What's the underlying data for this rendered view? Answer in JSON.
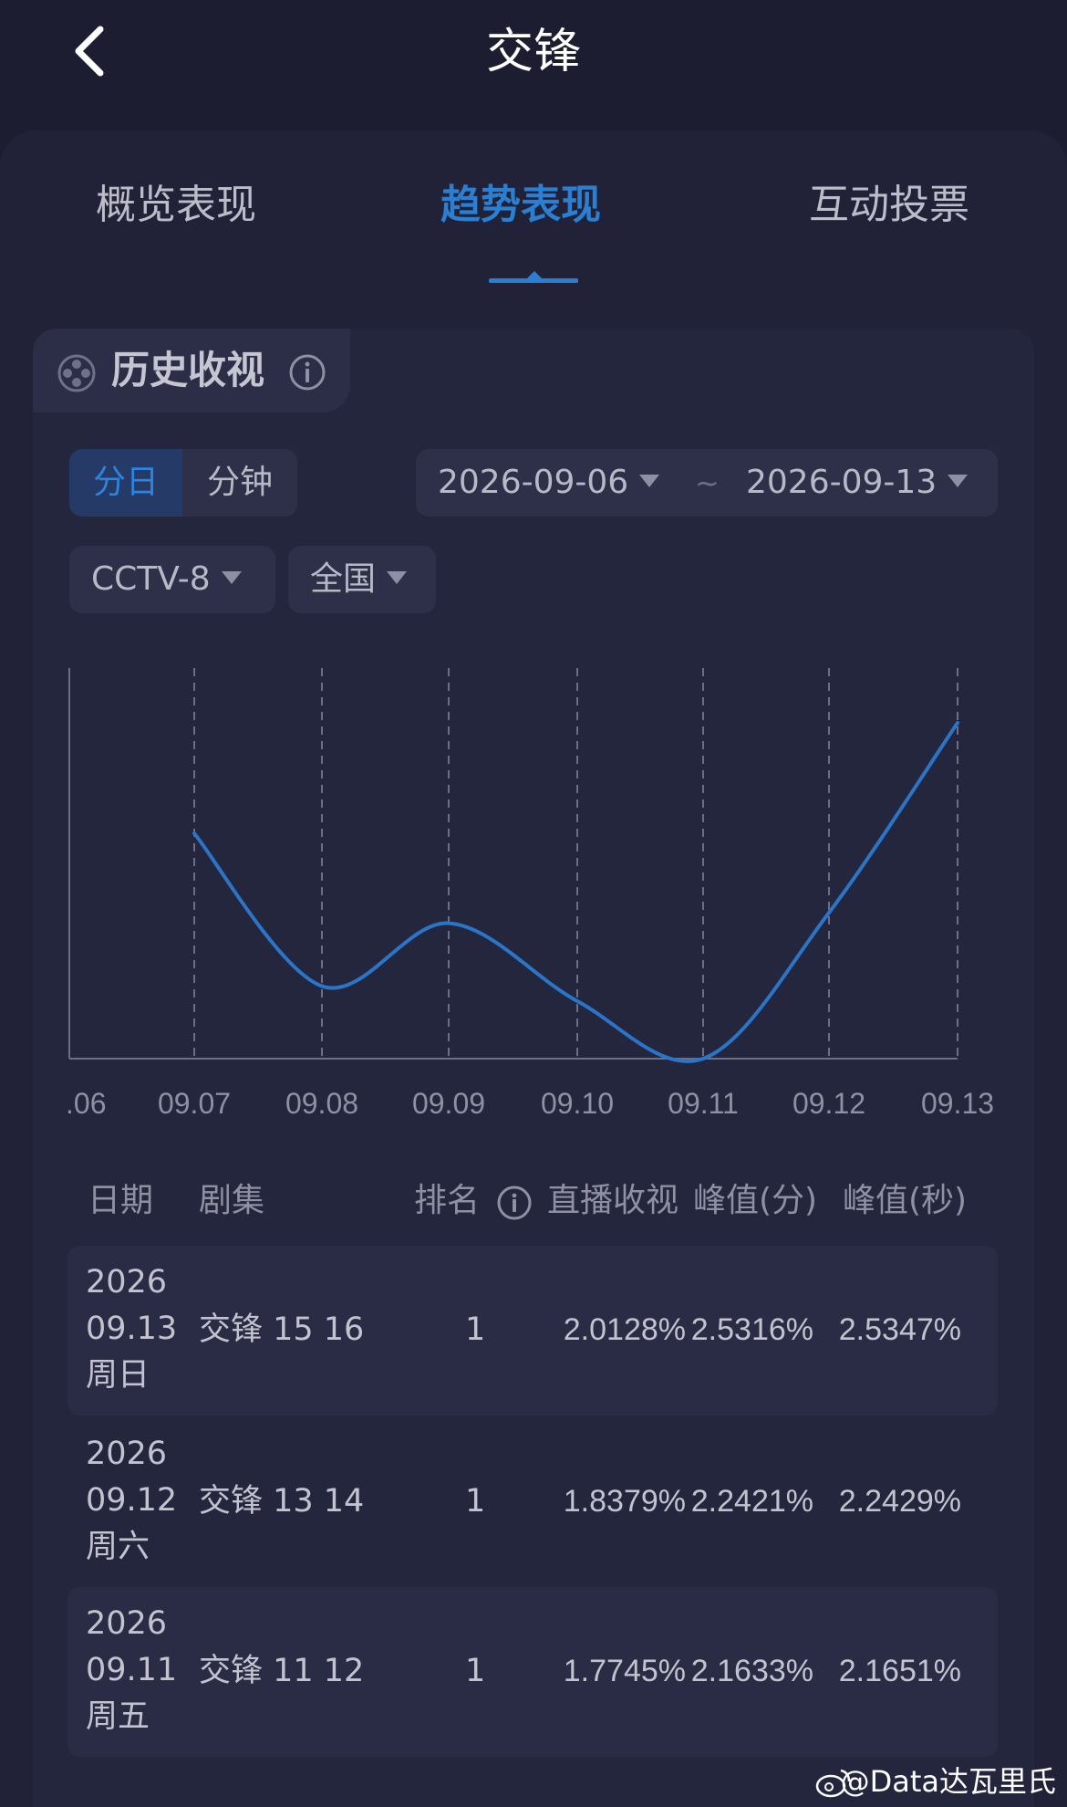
{
  "header": {
    "title": "交锋"
  },
  "tabs": [
    {
      "label": "概览表现"
    },
    {
      "label": "趋势表现"
    },
    {
      "label": "互动投票"
    }
  ],
  "section": {
    "title": "历史收视"
  },
  "controls": {
    "granularity": [
      "分日",
      "分钟"
    ],
    "start_date": "2026-09-06",
    "separator": "~",
    "end_date": "2026-09-13",
    "channel": "CCTV-8",
    "region": "全国"
  },
  "chart_data": {
    "type": "line",
    "x": [
      ".06",
      "09.07",
      "09.08",
      "09.09",
      "09.10",
      "09.11",
      "09.12",
      "09.13"
    ],
    "series": [
      {
        "values": [
          null,
          1.801,
          1.75,
          1.771,
          1.745,
          1.7258,
          1.7745,
          1.8379
        ]
      }
    ],
    "xlabel": "",
    "ylabel": "",
    "grid": "vertical dashed",
    "line_color": "#2b75c8"
  },
  "table": {
    "headers": [
      "日期",
      "剧集",
      "排名",
      "直播收视",
      "峰值(分)",
      "峰值(秒)"
    ],
    "rows": [
      {
        "year": "2026",
        "date": "09.13",
        "weekday": "周日",
        "episode": "交锋 15 16",
        "rank": "1",
        "live": "2.0128%",
        "peak_min": "2.5316%",
        "peak_sec": "2.5347%"
      },
      {
        "year": "2026",
        "date": "09.12",
        "weekday": "周六",
        "episode": "交锋 13 14",
        "rank": "1",
        "live": "1.8379%",
        "peak_min": "2.2421%",
        "peak_sec": "2.2429%"
      },
      {
        "year": "2026",
        "date": "09.11",
        "weekday": "周五",
        "episode": "交锋 11 12",
        "rank": "1",
        "live": "1.7745%",
        "peak_min": "2.1633%",
        "peak_sec": "2.1651%"
      }
    ]
  },
  "watermark": "@Data达瓦里氏"
}
